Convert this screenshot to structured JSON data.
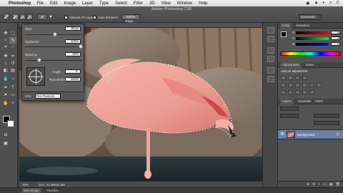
{
  "menubar": {
    "apple_icon": "",
    "app": "Photoshop",
    "items": [
      "File",
      "Edit",
      "Image",
      "Layer",
      "Type",
      "Select",
      "Filter",
      "3D",
      "View",
      "Window",
      "Help"
    ],
    "status_icons": [
      "◉",
      "▲",
      "◐",
      "⌕",
      "≡"
    ]
  },
  "options_bar": {
    "title": "Adobe Photoshop CS6",
    "sample_all_layers": "Sample All Layers",
    "auto_enhance": "Auto-Enhance",
    "refine_edge": "Refine Edge...",
    "workspace": "Essentials",
    "brush_size_value": "30"
  },
  "brush_popup": {
    "size_label": "Size:",
    "size_value": "99 px",
    "hardness_label": "Hardness:",
    "hardness_value": "100%",
    "spacing_label": "Spacing:",
    "spacing_value": "25%",
    "angle_label": "Angle:",
    "angle_value": "0°",
    "roundness_label": "Roundness:",
    "roundness_value": "100%",
    "pen_label": "Size:",
    "pen_value": "Pen Pressure"
  },
  "status_bar": {
    "zoom": "25%",
    "doc": "Doc: 41.3M/41.3M"
  },
  "right_panels": {
    "color_tabs": [
      "Color",
      "Swatches"
    ],
    "channel_labels": [
      "R",
      "G",
      "B"
    ],
    "channel_values": [
      "0",
      "0",
      "0"
    ],
    "adjust_tabs": [
      "Adjustments",
      "Styles"
    ],
    "adjust_title": "Add an adjustment",
    "layers_tabs": [
      "Layers",
      "Channels",
      "Paths"
    ],
    "layer_name": "Background",
    "footer_icons": [
      "⊕",
      "fx",
      "◐",
      "▭",
      "▣",
      "🗑"
    ]
  },
  "bottom_bar": {
    "tabs": [
      "Mini Bridge",
      "Timeline"
    ]
  },
  "colors": {
    "ui_dark": "#3c3c3c",
    "panel": "#535353",
    "selected_layer": "#6a80a8",
    "flamingo": "#f0a8a0"
  },
  "icons": {
    "tools": [
      "move-icon",
      "marquee-icon",
      "lasso-icon",
      "quick-selection-icon",
      "crop-icon",
      "eyedropper-icon",
      "healing-brush-icon",
      "brush-icon",
      "clone-stamp-icon",
      "history-brush-icon",
      "eraser-icon",
      "gradient-icon",
      "blur-icon",
      "dodge-icon",
      "pen-icon",
      "type-icon",
      "path-selection-icon",
      "shape-icon",
      "hand-icon",
      "zoom-icon"
    ]
  }
}
